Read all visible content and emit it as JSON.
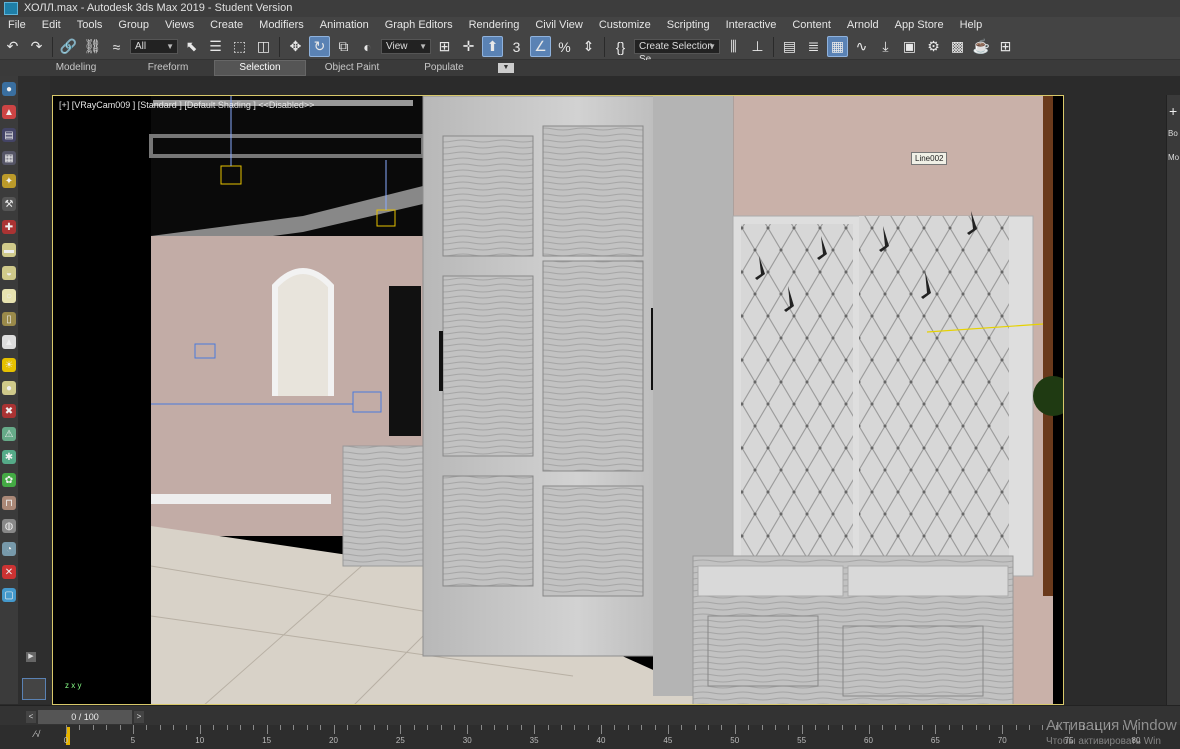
{
  "window": {
    "title": "ХОЛЛ.max - Autodesk 3ds Max 2019 - Student Version"
  },
  "menu": [
    "File",
    "Edit",
    "Tools",
    "Group",
    "Views",
    "Create",
    "Modifiers",
    "Animation",
    "Graph Editors",
    "Rendering",
    "Civil View",
    "Customize",
    "Scripting",
    "Interactive",
    "Content",
    "Arnold",
    "App Store",
    "Help"
  ],
  "toolbar": {
    "filter_select": "All",
    "refcoord_select": "View",
    "snap_label": "3",
    "named_selection": "Create Selection Se"
  },
  "ribbon": {
    "tabs": [
      "Modeling",
      "Freeform",
      "Selection",
      "Object Paint",
      "Populate"
    ],
    "active_tab": "Selection"
  },
  "viewport": {
    "label": "[+] [VRayCam009 ] [Standard ] [Default Shading ]  <<Disabled>>",
    "object_tag": "Line002",
    "axis_label": "z  x y"
  },
  "right_panel": {
    "items": [
      "Bo",
      "Mo"
    ]
  },
  "timeline": {
    "frame_display": "0 / 100",
    "key_label": "⁄√",
    "ticks": [
      0,
      5,
      10,
      15,
      20,
      25,
      30,
      35,
      40,
      45,
      50,
      55,
      60,
      65,
      70,
      75,
      80
    ]
  },
  "watermark": {
    "line1": "Активация Window",
    "line2": "Чтобы активировать Win"
  },
  "colors": {
    "accent": "#5a82b4",
    "viewport_border": "#d8c86a",
    "time_cursor": "#e6b400"
  }
}
